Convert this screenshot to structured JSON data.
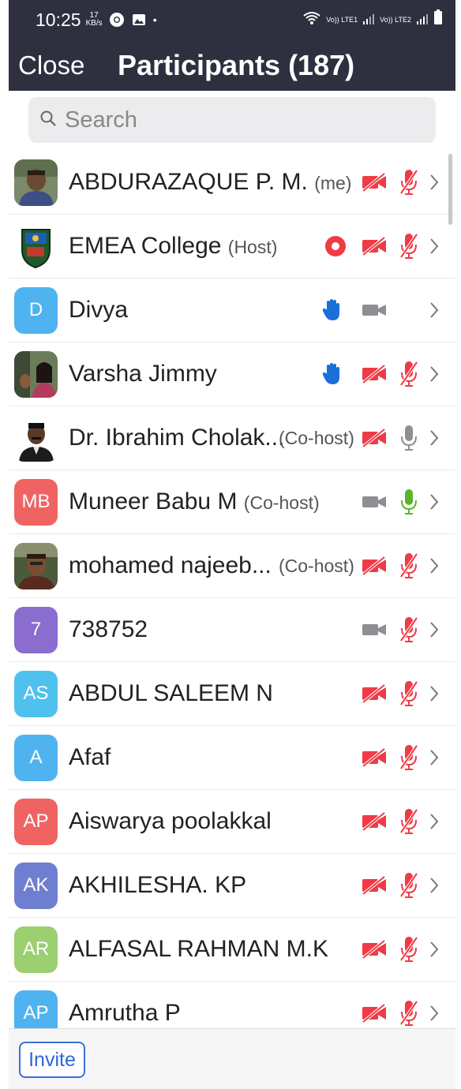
{
  "status_bar": {
    "time": "10:25",
    "speed_value": "17",
    "speed_unit": "KB/s",
    "dot": "•",
    "sim1": "Vo)) LTE1",
    "sim2": "Vo)) LTE2"
  },
  "header": {
    "close_label": "Close",
    "title": "Participants (187)"
  },
  "search": {
    "placeholder": "Search"
  },
  "colors": {
    "header_bg": "#2e3040",
    "muted_red": "#ef3b45",
    "hand_blue": "#1a6fd8",
    "mic_green": "#5ab52a",
    "icon_gray": "#8e8e93"
  },
  "participants": [
    {
      "name": "ABDURAZAQUE P. M.",
      "role": "(me)",
      "avatar": "photo",
      "video": "off",
      "mic": "muted"
    },
    {
      "name": "EMEA College",
      "role": "(Host)",
      "avatar": "logo",
      "recording": true,
      "video": "off",
      "mic": "muted"
    },
    {
      "name": "Divya",
      "role": "",
      "avatar_text": "D",
      "avatar_color": "#4fb3f0",
      "hand": true,
      "video": "on",
      "mic": "none"
    },
    {
      "name": "Varsha Jimmy",
      "role": "",
      "avatar": "photo",
      "hand": true,
      "video": "off",
      "mic": "muted"
    },
    {
      "name": "Dr. Ibrahim Cholak...",
      "role": "(Co-host)",
      "avatar": "photo",
      "video": "off",
      "mic": "unmuted-gray"
    },
    {
      "name": "Muneer Babu M",
      "role": "(Co-host)",
      "avatar_text": "MB",
      "avatar_color": "#f06363",
      "video": "on",
      "mic": "active"
    },
    {
      "name": "mohamed najeeb...",
      "role": "(Co-host)",
      "avatar": "photo",
      "video": "off",
      "mic": "muted"
    },
    {
      "name": "738752",
      "role": "",
      "avatar_text": "7",
      "avatar_color": "#8b6ccf",
      "video": "on",
      "mic": "muted"
    },
    {
      "name": "ABDUL SALEEM N",
      "role": "",
      "avatar_text": "AS",
      "avatar_color": "#4fc1ee",
      "video": "off",
      "mic": "muted"
    },
    {
      "name": "Afaf",
      "role": "",
      "avatar_text": "A",
      "avatar_color": "#4fb3f0",
      "video": "off",
      "mic": "muted"
    },
    {
      "name": "Aiswarya poolakkal",
      "role": "",
      "avatar_text": "AP",
      "avatar_color": "#f06363",
      "video": "off",
      "mic": "muted"
    },
    {
      "name": "AKHILESHA. KP",
      "role": "",
      "avatar_text": "AK",
      "avatar_color": "#6f7fcf",
      "video": "off",
      "mic": "muted"
    },
    {
      "name": "ALFASAL RAHMAN M.K",
      "role": "",
      "avatar_text": "AR",
      "avatar_color": "#9ccf70",
      "video": "off",
      "mic": "muted"
    },
    {
      "name": "Amrutha P",
      "role": "",
      "avatar_text": "AP",
      "avatar_color": "#4fb3f0",
      "video": "off",
      "mic": "muted"
    }
  ],
  "footer": {
    "invite_label": "Invite"
  }
}
